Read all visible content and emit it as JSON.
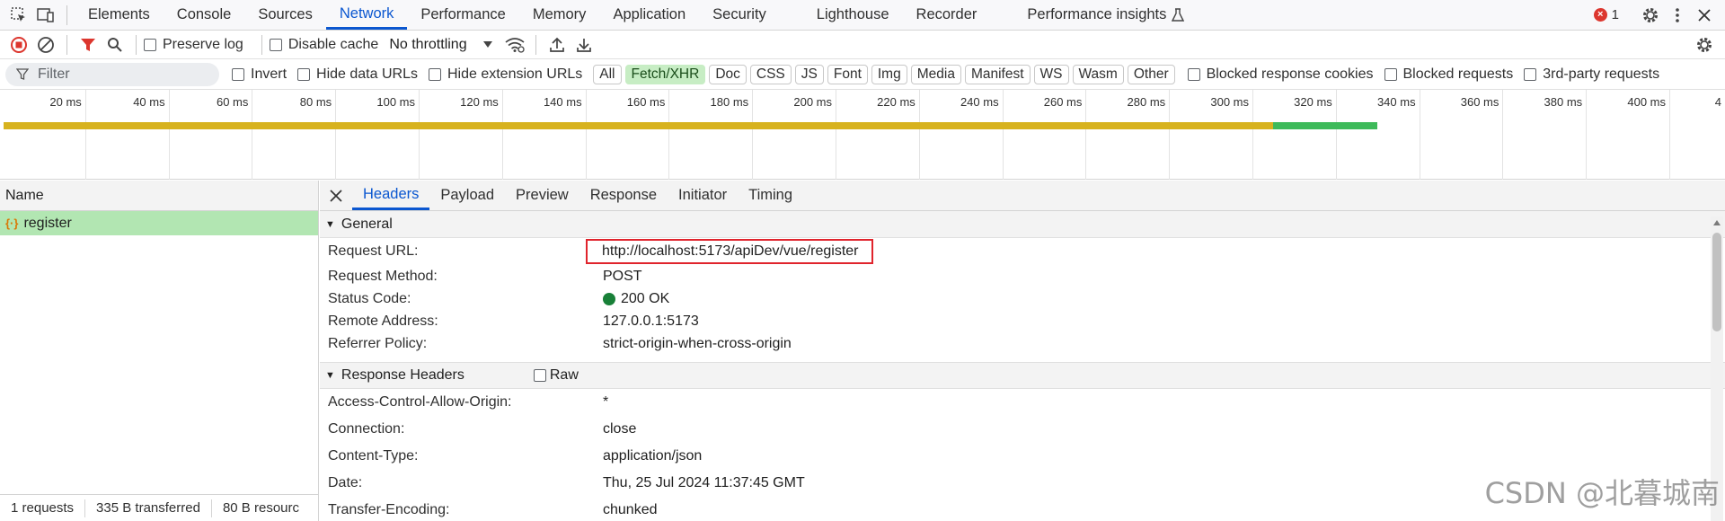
{
  "top_tabs": [
    "Elements",
    "Console",
    "Sources",
    "Network",
    "Performance",
    "Memory",
    "Application",
    "Security",
    "Lighthouse",
    "Recorder",
    "Performance insights"
  ],
  "active_top_tab": "Network",
  "error_count": "1",
  "toolbar": {
    "preserve_log": "Preserve log",
    "disable_cache": "Disable cache",
    "throttling": "No throttling"
  },
  "filter": {
    "placeholder": "Filter",
    "invert": "Invert",
    "hide_data_urls": "Hide data URLs",
    "hide_extension_urls": "Hide extension URLs",
    "types": [
      "All",
      "Fetch/XHR",
      "Doc",
      "CSS",
      "JS",
      "Font",
      "Img",
      "Media",
      "Manifest",
      "WS",
      "Wasm",
      "Other"
    ],
    "active_type": "Fetch/XHR",
    "blocked_cookies": "Blocked response cookies",
    "blocked_requests": "Blocked requests",
    "third_party": "3rd-party requests"
  },
  "timeline": {
    "ticks": [
      "20 ms",
      "40 ms",
      "60 ms",
      "80 ms",
      "100 ms",
      "120 ms",
      "140 ms",
      "160 ms",
      "180 ms",
      "200 ms",
      "220 ms",
      "240 ms",
      "260 ms",
      "280 ms",
      "300 ms",
      "320 ms",
      "340 ms",
      "360 ms",
      "380 ms",
      "400 ms",
      "4"
    ],
    "waiting_end_ms": 305,
    "download_end_ms": 330,
    "colors": {
      "waiting": "#d7b21e",
      "download": "#3dba5a"
    }
  },
  "requests_panel": {
    "name_header": "Name",
    "requests": [
      {
        "name": "register",
        "icon": "xhr-icon"
      }
    ],
    "status": {
      "requests": "1 requests",
      "transferred": "335 B transferred",
      "resources": "80 B resourc"
    }
  },
  "detail_tabs": [
    "Headers",
    "Payload",
    "Preview",
    "Response",
    "Initiator",
    "Timing"
  ],
  "active_detail_tab": "Headers",
  "general": {
    "title": "General",
    "rows": [
      {
        "key": "Request URL:",
        "value": "http://localhost:5173/apiDev/vue/register"
      },
      {
        "key": "Request Method:",
        "value": "POST"
      },
      {
        "key": "Status Code:",
        "value": "200 OK"
      },
      {
        "key": "Remote Address:",
        "value": "127.0.0.1:5173"
      },
      {
        "key": "Referrer Policy:",
        "value": "strict-origin-when-cross-origin"
      }
    ]
  },
  "response_headers": {
    "title": "Response Headers",
    "raw_label": "Raw",
    "rows": [
      {
        "key": "Access-Control-Allow-Origin:",
        "value": "*"
      },
      {
        "key": "Connection:",
        "value": "close"
      },
      {
        "key": "Content-Type:",
        "value": "application/json"
      },
      {
        "key": "Date:",
        "value": "Thu, 25 Jul 2024 11:37:45 GMT"
      },
      {
        "key": "Transfer-Encoding:",
        "value": "chunked"
      }
    ]
  },
  "watermark": "CSDN @北暮城南"
}
